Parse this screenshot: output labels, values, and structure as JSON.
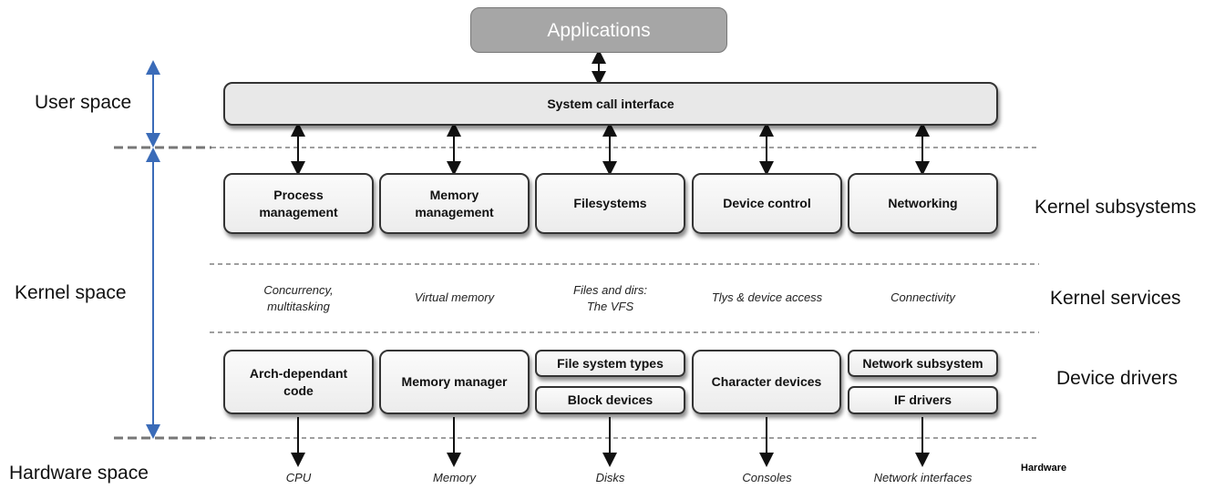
{
  "applications": "Applications",
  "syscall": "System call interface",
  "subsystems": [
    "Process\nmanagement",
    "Memory\nmanagement",
    "Filesystems",
    "Device control",
    "Networking"
  ],
  "services": [
    "Concurrency,\nmultitasking",
    "Virtual memory",
    "Files and dirs:\nThe VFS",
    "Tlys & device access",
    "Connectivity"
  ],
  "drivers": {
    "arch": "Arch-dependant\ncode",
    "memory": "Memory manager",
    "fstypes": "File system types",
    "block": "Block devices",
    "char": "Character devices",
    "netsub": "Network subsystem",
    "ifdrivers": "IF drivers"
  },
  "hardware": [
    "CPU",
    "Memory",
    "Disks",
    "Consoles",
    "Network interfaces"
  ],
  "left_labels": {
    "user": "User space",
    "kernel": "Kernel space",
    "hardware": "Hardware space"
  },
  "right_labels": {
    "subsystems": "Kernel subsystems",
    "services": "Kernel services",
    "drivers": "Device drivers",
    "hardware": "Hardware"
  },
  "colors": {
    "applications": "#a6a6a6",
    "bracket_arrow": "#3a6bb8",
    "syscall": "#e8e8e8"
  }
}
